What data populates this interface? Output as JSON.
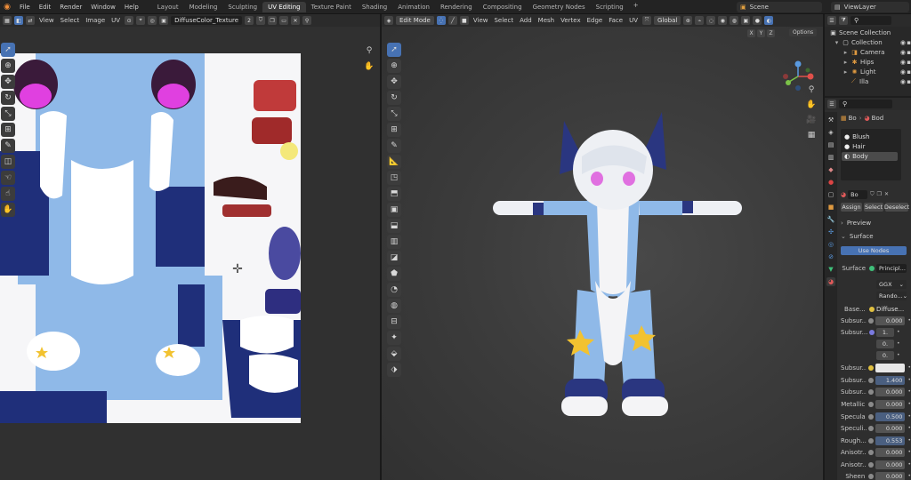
{
  "menu": [
    "File",
    "Edit",
    "Render",
    "Window",
    "Help"
  ],
  "workspaces": [
    "Layout",
    "Modeling",
    "Sculpting",
    "UV Editing",
    "Texture Paint",
    "Shading",
    "Animation",
    "Rendering",
    "Compositing",
    "Geometry Nodes",
    "Scripting"
  ],
  "active_workspace": "UV Editing",
  "scene": "Scene",
  "view_layer": "ViewLayer",
  "uv_editor": {
    "menus": [
      "View",
      "Select",
      "Image",
      "UV"
    ],
    "image_name": "DiffuseColor_Texture",
    "users": "2"
  },
  "viewport": {
    "mode": "Edit Mode",
    "menus": [
      "View",
      "Select",
      "Add",
      "Mesh",
      "Vertex",
      "Edge",
      "Face",
      "UV"
    ],
    "orientation": "Global",
    "options": "Options",
    "axes": [
      "X",
      "Y",
      "Z"
    ]
  },
  "outliner": {
    "scene_collection": "Scene Collection",
    "collection": "Collection",
    "items": [
      "Camera",
      "Hips",
      "Light",
      "Illa"
    ]
  },
  "properties": {
    "object_short": "Bo",
    "material_short": "Bod",
    "slots": [
      "Blush",
      "Hair",
      "Body"
    ],
    "slot_field": "Bo",
    "assign": "Assign",
    "select": "Select",
    "deselect": "Deselect",
    "preview": "Preview",
    "surface_section": "Surface",
    "use_nodes": "Use Nodes",
    "surface_label": "Surface",
    "surface_value": "Principl...",
    "distribution": "GGX",
    "subsurface_method": "Rando...",
    "base_label": "Base...",
    "base_value": "Diffuse...",
    "rows": [
      {
        "label": "Subsur...",
        "value": "0.000"
      },
      {
        "label": "Subsur...",
        "value": "1."
      },
      {
        "label": "",
        "value": "0."
      },
      {
        "label": "",
        "value": "0."
      },
      {
        "label": "Subsur...",
        "value": ""
      },
      {
        "label": "Subsur...",
        "value": "1.400"
      },
      {
        "label": "Subsur...",
        "value": "0.000"
      },
      {
        "label": "Metallic",
        "value": "0.000"
      },
      {
        "label": "Specula",
        "value": "0.500"
      },
      {
        "label": "Speculi...",
        "value": "0.000"
      },
      {
        "label": "Rough...",
        "value": "0.553"
      },
      {
        "label": "Anisotr...",
        "value": "0.000"
      },
      {
        "label": "Anisotr...",
        "value": "0.000"
      },
      {
        "label": "Sheen",
        "value": "0.000"
      }
    ]
  },
  "colors": {
    "accent": "#4772b3",
    "uv_light_blue": "#8fb9e8",
    "uv_navy": "#1f2f7a",
    "star_yellow": "#f2c230",
    "eye_magenta": "#e040e0"
  }
}
